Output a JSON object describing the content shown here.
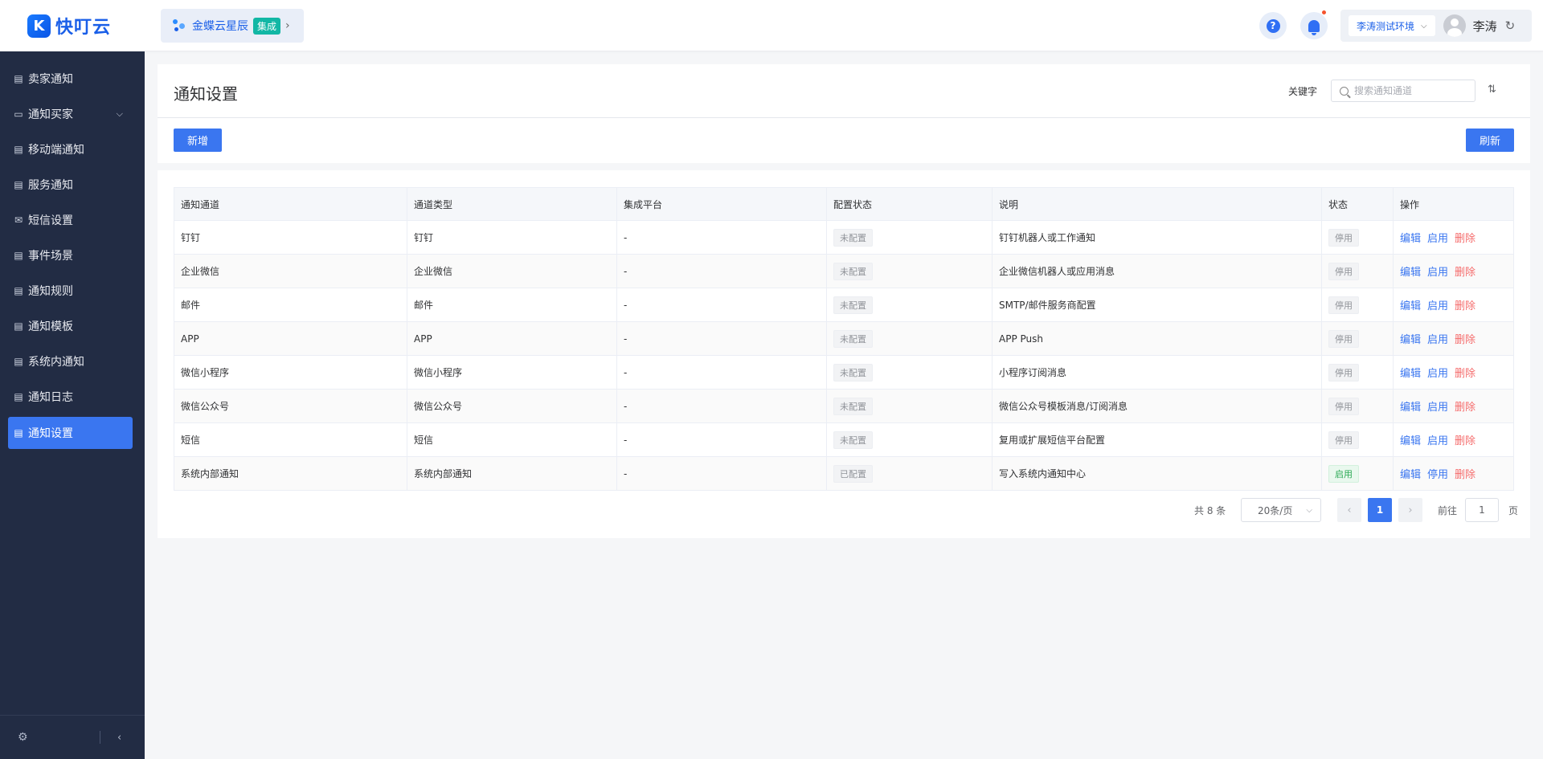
{
  "app": {
    "logo_text": "快叮云",
    "logo_letter": "K"
  },
  "product": {
    "name": "金蝶云星辰",
    "tag": "集成"
  },
  "header_actions": {
    "help_glyph": "?"
  },
  "user": {
    "environment": "李涛测试环境",
    "name": "李涛"
  },
  "sidebar": {
    "items": [
      {
        "label": "卖家通知",
        "icon": "stack-icon",
        "active": false
      },
      {
        "label": "通知买家",
        "icon": "chat-icon",
        "active": false,
        "expandable": true
      },
      {
        "label": "移动端通知",
        "icon": "stack-icon",
        "active": false
      },
      {
        "label": "服务通知",
        "icon": "stack-icon",
        "active": false
      },
      {
        "label": "短信设置",
        "icon": "mail-icon",
        "active": false
      },
      {
        "label": "事件场景",
        "icon": "stack-icon",
        "active": false
      },
      {
        "label": "通知规则",
        "icon": "stack-icon",
        "active": false
      },
      {
        "label": "通知模板",
        "icon": "stack-icon",
        "active": false
      },
      {
        "label": "系统内通知",
        "icon": "stack-icon",
        "active": false
      },
      {
        "label": "通知日志",
        "icon": "stack-icon",
        "active": false
      },
      {
        "label": "通知设置",
        "icon": "stack-icon",
        "active": true
      }
    ]
  },
  "page": {
    "title": "通知设置",
    "keyword_label": "关键字",
    "search_placeholder": "搜索通知通道",
    "add_label": "新增",
    "refresh_label": "刷新"
  },
  "table": {
    "columns": [
      "通知通道",
      "通道类型",
      "集成平台",
      "配置状态",
      "说明",
      "状态",
      "操作"
    ],
    "rows": [
      {
        "channel": "钉钉",
        "type": "钉钉",
        "platform": "-",
        "config": "未配置",
        "desc": "钉钉机器人或工作通知",
        "status": "停用",
        "toggle": "启用"
      },
      {
        "channel": "企业微信",
        "type": "企业微信",
        "platform": "-",
        "config": "未配置",
        "desc": "企业微信机器人或应用消息",
        "status": "停用",
        "toggle": "启用"
      },
      {
        "channel": "邮件",
        "type": "邮件",
        "platform": "-",
        "config": "未配置",
        "desc": "SMTP/邮件服务商配置",
        "status": "停用",
        "toggle": "启用"
      },
      {
        "channel": "APP",
        "type": "APP",
        "platform": "-",
        "config": "未配置",
        "desc": "APP Push",
        "status": "停用",
        "toggle": "启用"
      },
      {
        "channel": "微信小程序",
        "type": "微信小程序",
        "platform": "-",
        "config": "未配置",
        "desc": "小程序订阅消息",
        "status": "停用",
        "toggle": "启用"
      },
      {
        "channel": "微信公众号",
        "type": "微信公众号",
        "platform": "-",
        "config": "未配置",
        "desc": "微信公众号模板消息/订阅消息",
        "status": "停用",
        "toggle": "启用"
      },
      {
        "channel": "短信",
        "type": "短信",
        "platform": "-",
        "config": "未配置",
        "desc": "复用或扩展短信平台配置",
        "status": "停用",
        "toggle": "启用"
      },
      {
        "channel": "系统内部通知",
        "type": "系统内部通知",
        "platform": "-",
        "config": "已配置",
        "desc": "写入系统内通知中心",
        "status": "启用",
        "toggle": "停用"
      }
    ],
    "edit_label": "编辑",
    "delete_label": "删除"
  },
  "pagination": {
    "total_text": "共 8 条",
    "page_size": "20条/页",
    "current_page": "1",
    "goto_label": "前往",
    "goto_value": "1",
    "page_unit": "页"
  },
  "colors": {
    "primary": "#3a76f0",
    "sidebar_bg": "#222c44",
    "danger": "#f56c6c",
    "success": "#2aa954"
  }
}
